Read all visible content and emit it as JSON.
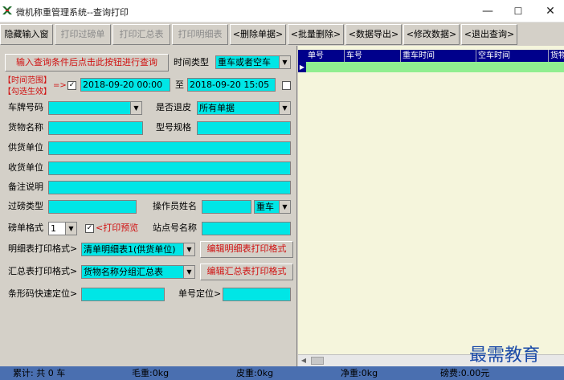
{
  "window": {
    "title": "微机称重管理系统--查询打印",
    "minimize": "—",
    "maximize": "☐",
    "close": "✕"
  },
  "toolbar": [
    {
      "label": "隐藏输入窗",
      "enabled": true
    },
    {
      "label": "打印过磅单",
      "enabled": false
    },
    {
      "label": "打印汇总表",
      "enabled": false
    },
    {
      "label": "打印明细表",
      "enabled": false
    },
    {
      "label": "<删除单据>",
      "enabled": true
    },
    {
      "label": "<批量删除>",
      "enabled": true
    },
    {
      "label": "<数据导出>",
      "enabled": true
    },
    {
      "label": "<修改数据>",
      "enabled": true
    },
    {
      "label": "<退出查询>",
      "enabled": true
    }
  ],
  "query": {
    "run_button": "输入查询条件后点击此按钮进行查询",
    "time_type_label": "时间类型",
    "time_type_value": "重车或者空车",
    "time_range_label": "【时间范围】",
    "check_effect_label": "【勾选生效】",
    "arrow": "=>",
    "time_range_checked": "✓",
    "start_time": "2018-09-20 00:00",
    "to_label": "至",
    "end_time": "2018-09-20 15:05",
    "plate_label": "车牌号码",
    "plate_value": "",
    "tare_label": "是否退皮",
    "tare_value": "所有单据",
    "goods_label": "货物名称",
    "goods_value": "",
    "model_label": "型号规格",
    "model_value": "",
    "supplier_label": "供货单位",
    "supplier_value": "",
    "receiver_label": "收货单位",
    "receiver_value": "",
    "remark_label": "备注说明",
    "remark_value": "",
    "weigh_type_label": "过磅类型",
    "weigh_type_value": "",
    "operator_label": "操作员姓名",
    "operator_value": "",
    "operator_vehicle": "重车",
    "format_label": "磅单格式",
    "format_value": "1",
    "preview_checked": "✓",
    "preview_label": "<打印预览",
    "station_label": "站点号名称",
    "station_value": "",
    "detail_print_label": "明细表打印格式>",
    "detail_print_value": "清单明细表1(供货单位)",
    "detail_edit_button": "编辑明细表打印格式",
    "summary_print_label": "汇总表打印格式>",
    "summary_print_value": "货物名称分组汇总表",
    "summary_edit_button": "编辑汇总表打印格式",
    "barcode_label": "条形码快速定位>",
    "barcode_value": "",
    "docno_label": "单号定位>",
    "docno_value": ""
  },
  "grid": {
    "columns": [
      "单号",
      "车号",
      "重车时间",
      "空车时间",
      "货物"
    ],
    "row_indicator": "▶"
  },
  "status": {
    "total": "累计: 共 0 车",
    "gross": "毛重:0kg",
    "tare": "皮重:0kg",
    "net": "净重:0kg",
    "fee": "磅费:0.00元"
  },
  "watermark": "最需教育"
}
